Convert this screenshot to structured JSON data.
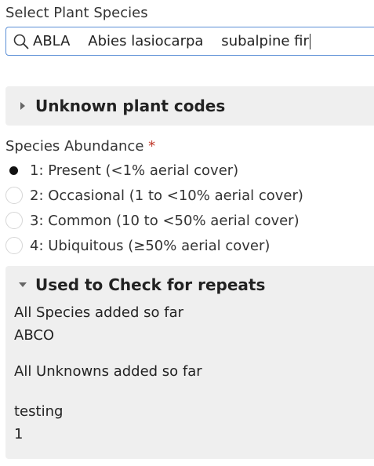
{
  "species_select": {
    "label": "Select Plant Species",
    "value": "ABLA    Abies lasiocarpa    subalpine fir"
  },
  "unknown_codes": {
    "title": "Unknown plant codes",
    "expanded": false
  },
  "abundance": {
    "label": "Species Abundance",
    "required_marker": "*",
    "options": [
      {
        "label": "1: Present (<1% aerial cover)",
        "checked": true
      },
      {
        "label": "2: Occasional (1 to <10% aerial cover)",
        "checked": false
      },
      {
        "label": "3: Common (10 to <50% aerial cover)",
        "checked": false
      },
      {
        "label": "4: Ubiquitous (≥50% aerial cover)",
        "checked": false
      }
    ]
  },
  "repeats": {
    "title": "Used to Check for repeats",
    "expanded": true,
    "species_heading": "All Species added so far",
    "species_value": "ABCO",
    "unknowns_heading": "All Unknowns added so far",
    "unknowns_value": "",
    "extra_heading": "testing",
    "extra_value": "1"
  }
}
